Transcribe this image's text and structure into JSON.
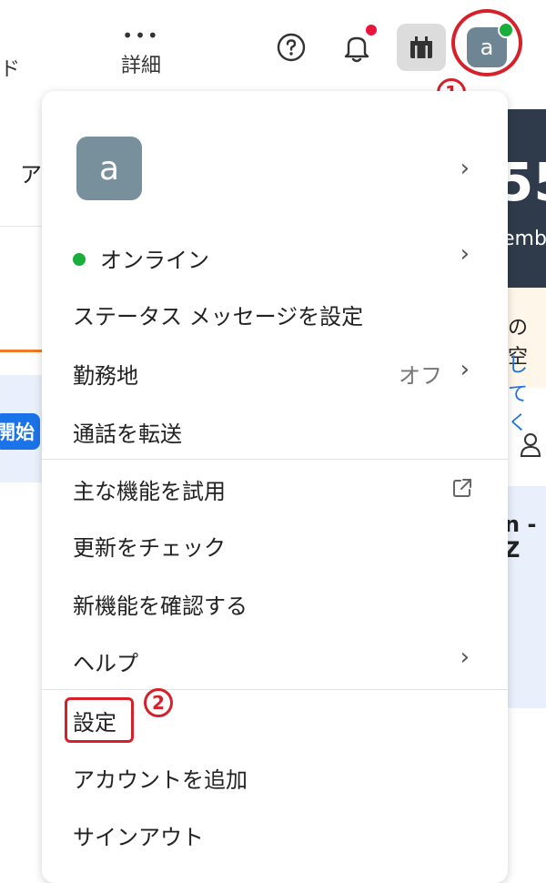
{
  "topbar": {
    "left_label": "ド",
    "more_label": "詳細",
    "more_icon": "ellipsis-icon",
    "help_icon": "help-circle-icon",
    "bell_icon": "bell-icon",
    "whiteboard_icon": "gift-box-icon",
    "avatar_letter": "a"
  },
  "background": {
    "left_text": "ア",
    "button_text": "開始",
    "number_text": "55",
    "date_text": "emb",
    "line1": "の空",
    "line2": "してく",
    "row_text": "n -Z"
  },
  "annotations": {
    "marker1": "1",
    "marker2": "2"
  },
  "menu": {
    "avatar_letter": "a",
    "items": [
      {
        "label": "オンライン"
      },
      {
        "label": "ステータス メッセージを設定"
      },
      {
        "label": "勤務地",
        "value": "オフ"
      },
      {
        "label": "通話を転送"
      },
      {
        "label": "主な機能を試用"
      },
      {
        "label": "更新をチェック"
      },
      {
        "label": "新機能を確認する"
      },
      {
        "label": "ヘルプ"
      },
      {
        "label": "設定"
      },
      {
        "label": "アカウントを追加"
      },
      {
        "label": "サインアウト"
      }
    ]
  },
  "colors": {
    "accent_red": "#d6202a",
    "online_green": "#1aae3a",
    "avatar_gray": "#78909c",
    "banner_dark": "#2f3b4a",
    "button_blue": "#1a73e8"
  }
}
